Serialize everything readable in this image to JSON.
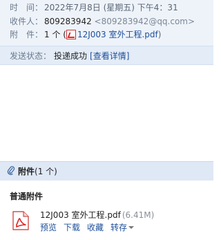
{
  "mail": {
    "time_label": "时　间：",
    "time_value": "2022年7月8日 (星期五) 下午4：31",
    "to_label": "收件人：",
    "to_name": "809283942",
    "to_email": "<809283942@qq.com>",
    "attach_label": "附　件：",
    "attach_count_text": "1 个 (",
    "attach_link": "12J003  室外工程.pdf",
    "attach_close": ")"
  },
  "status": {
    "label": "发送状态：",
    "value": "投递成功",
    "detail": "[查看详情]"
  },
  "attachments": {
    "title": "附件",
    "count": "(1 个)",
    "section": "普通附件",
    "file": {
      "name": "12J003 室外工程.pdf",
      "size": "(6.41M)",
      "actions": {
        "preview": "预览",
        "download": "下载",
        "favorite": "收藏",
        "save_to": "转存"
      }
    }
  },
  "colors": {
    "header_bg": "#eef3fa",
    "status_bg": "#e3ecf7",
    "link": "#1e4f99",
    "pdf_red": "#d22"
  }
}
